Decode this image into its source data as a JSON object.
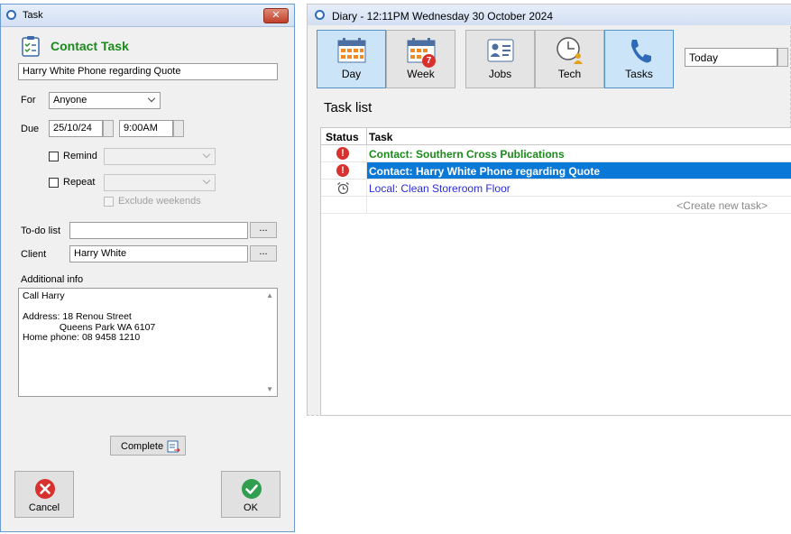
{
  "task_window": {
    "title": "Task",
    "close_label": "✕",
    "heading": "Contact Task",
    "subject": "Harry White Phone regarding Quote",
    "for_label": "For",
    "for_value": "Anyone",
    "due_label": "Due",
    "due_date": "25/10/24",
    "due_time": "9:00AM",
    "remind_label": "Remind",
    "repeat_label": "Repeat",
    "exclude_weekends_label": "Exclude weekends",
    "todo_label": "To-do list",
    "todo_value": "",
    "ellipsis": "...",
    "client_label": "Client",
    "client_value": "Harry White",
    "additional_label": "Additional info",
    "additional_text": "Call Harry\n\nAddress: 18 Renou Street\n              Queens Park WA 6107\nHome phone: 08 9458 1210",
    "complete_label": "Complete",
    "cancel_label": "Cancel",
    "ok_label": "OK"
  },
  "diary_window": {
    "title": "Diary - 12:11PM Wednesday 30 October 2024",
    "toolbar": {
      "day": "Day",
      "week": "Week",
      "week_badge": "7",
      "jobs": "Jobs",
      "tech": "Tech",
      "tasks": "Tasks"
    },
    "date_field": "Today",
    "task_list_title": "Task list",
    "columns": {
      "status": "Status",
      "task": "Task"
    },
    "tasks": [
      {
        "text": "Contact: Southern Cross Publications",
        "status_icon": "alert-icon"
      },
      {
        "text": "Contact: Harry White Phone regarding Quote",
        "status_icon": "alert-icon"
      },
      {
        "text": "Local: Clean Storeroom Floor",
        "status_icon": "alarm-clock-icon"
      }
    ],
    "create_new": "<Create new task>"
  },
  "colors": {
    "heading_green": "#1b8a1b",
    "selection_blue": "#0a78d7",
    "local_task_blue": "#2a2ad8",
    "alert_red": "#d8302c"
  }
}
